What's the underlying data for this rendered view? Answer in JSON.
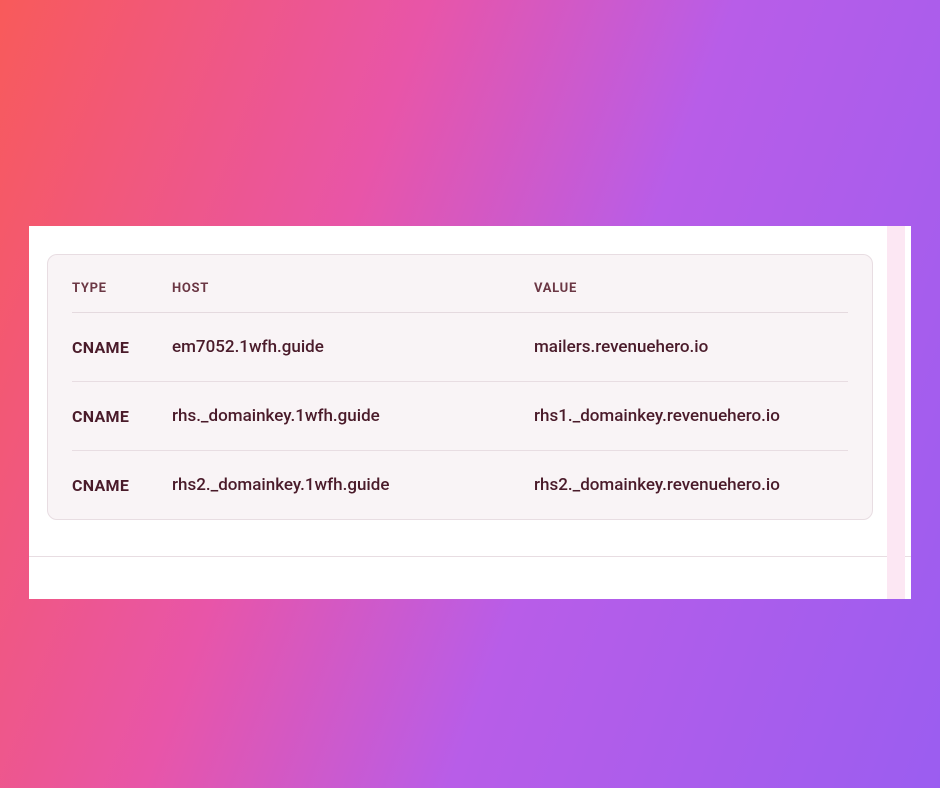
{
  "table": {
    "headers": {
      "type": "TYPE",
      "host": "HOST",
      "value": "VALUE"
    },
    "rows": [
      {
        "type": "CNAME",
        "host": "em7052.1wfh.guide",
        "value": "mailers.revenuehero.io"
      },
      {
        "type": "CNAME",
        "host": "rhs._domainkey.1wfh.guide",
        "value": "rhs1._domainkey.revenuehero.io"
      },
      {
        "type": "CNAME",
        "host": "rhs2._domainkey.1wfh.guide",
        "value": "rhs2._domainkey.revenuehero.io"
      }
    ]
  }
}
